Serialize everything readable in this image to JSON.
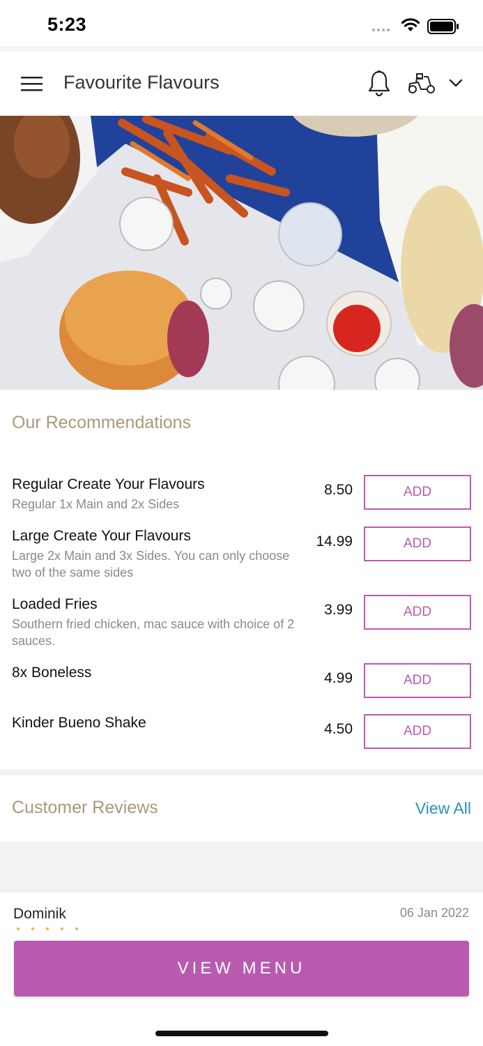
{
  "status_bar": {
    "time": "5:23"
  },
  "header": {
    "title": "Favourite Flavours",
    "icons": [
      "menu-icon",
      "bell-icon",
      "scooter-icon",
      "chevron-down-icon"
    ]
  },
  "recommendations": {
    "title": "Our Recommendations",
    "items": [
      {
        "name": "Regular Create Your Flavours",
        "description": "Regular 1x Main and 2x Sides",
        "price": "8.50",
        "button": "ADD"
      },
      {
        "name": "Large Create Your Flavours",
        "description": "Large 2x Main and 3x Sides. You can only choose two of the same sides",
        "price": "14.99",
        "button": "ADD"
      },
      {
        "name": "Loaded Fries",
        "description": "Southern fried chicken, mac sauce with choice of 2 sauces.",
        "price": "3.99",
        "button": "ADD"
      },
      {
        "name": "8x Boneless",
        "description": "",
        "price": "4.99",
        "button": "ADD"
      },
      {
        "name": "Kinder Bueno Shake",
        "description": "",
        "price": "4.50",
        "button": "ADD"
      }
    ]
  },
  "reviews": {
    "title": "Customer Reviews",
    "view_all": "View All",
    "first_review": {
      "name": "Dominik",
      "date": "06 Jan 2022",
      "rating": 5
    }
  },
  "cta": {
    "label": "VIEW MENU"
  },
  "colors": {
    "accent": "#b85bb0",
    "section_title": "#a9997a",
    "link": "#2d8fbf"
  }
}
